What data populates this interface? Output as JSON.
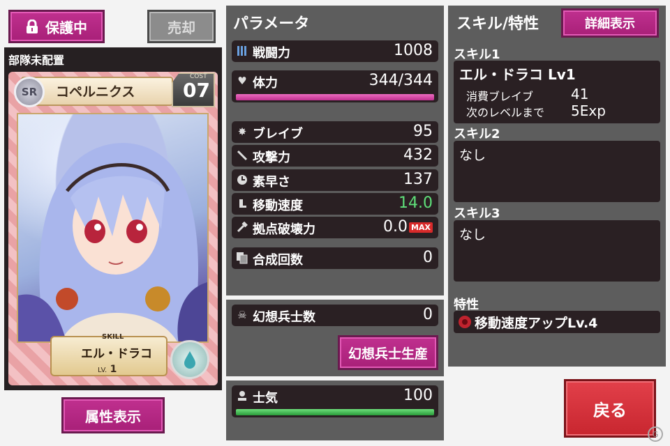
{
  "left": {
    "protect_label": "保護中",
    "sell_label": "売却",
    "deploy_status": "部隊未配置",
    "attribute_button": "属性表示"
  },
  "card": {
    "rarity": "SR",
    "name": "コペルニクス",
    "cost_label": "COST",
    "cost": "07",
    "skill_label": "SKILL",
    "skill_name": "エル・ドラコ",
    "lv_label": "LV.",
    "lv": "1"
  },
  "params": {
    "title": "パラメータ",
    "combat": {
      "label": "戦闘力",
      "value": "1008"
    },
    "hp": {
      "label": "体力",
      "value": "344/344",
      "fill": 1.0
    },
    "brave": {
      "label": "ブレイブ",
      "value": "95"
    },
    "attack": {
      "label": "攻撃力",
      "value": "432"
    },
    "speed": {
      "label": "素早さ",
      "value": "137"
    },
    "move": {
      "label": "移動速度",
      "value": "14.0"
    },
    "destroy": {
      "label": "拠点破壊力",
      "value": "0.0",
      "badge": "MAX"
    },
    "merge": {
      "label": "合成回数",
      "value": "0"
    }
  },
  "soldiers": {
    "label": "幻想兵士数",
    "value": "0",
    "button": "幻想兵士生産"
  },
  "morale": {
    "label": "士気",
    "value": "100",
    "fill": 1.0
  },
  "skills": {
    "title": "スキル/特性",
    "detail_button": "詳細表示",
    "s1_label": "スキル1",
    "s1_name": "エル・ドラコ Lv1",
    "s1_cost_label": "消費ブレイブ",
    "s1_cost": "41",
    "s1_next_label": "次のレベルまで",
    "s1_next": "5Exp",
    "s2_label": "スキル2",
    "s2_value": "なし",
    "s3_label": "スキル3",
    "s3_value": "なし",
    "trait_label": "特性",
    "trait_value": "移動速度アップLv.4"
  },
  "back_button": "戻る",
  "colors": {
    "accent": "#b02880",
    "hp_bar": "#d84aa8",
    "morale_bar": "#3cbb4c",
    "move_value": "#5fe07a",
    "back": "#d8343e"
  }
}
